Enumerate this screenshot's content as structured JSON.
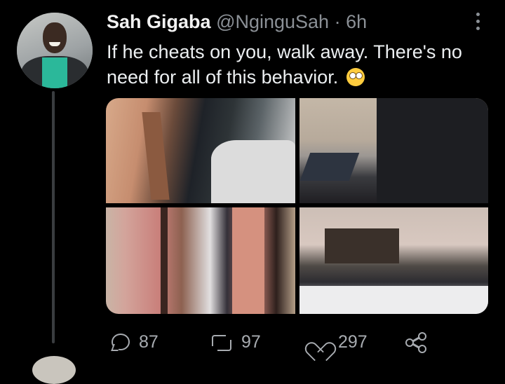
{
  "tweet": {
    "author_name": "Sah Gigaba",
    "author_handle": "@NginguSah",
    "separator": "·",
    "time": "6h",
    "text": "If he cheats on you, walk away. There's no need for all of this behavior.",
    "emoji": "face-with-rolling-eyes-emoji"
  },
  "media": {
    "count": 4,
    "photos": [
      {
        "subject": "doorway with clothes scattered"
      },
      {
        "subject": "dresser with items knocked over"
      },
      {
        "subject": "broken door frame"
      },
      {
        "subject": "room with clothes on floor"
      }
    ]
  },
  "actions": {
    "replies": "87",
    "retweets": "97",
    "likes": "297"
  },
  "icons": {
    "more": "more-options-icon",
    "reply": "reply-icon",
    "retweet": "retweet-icon",
    "like": "heart-icon",
    "share": "share-icon"
  },
  "colors": {
    "background": "#000000",
    "text": "#e7e9ea",
    "muted": "#8b9096",
    "thread_line": "#3a3d40"
  }
}
